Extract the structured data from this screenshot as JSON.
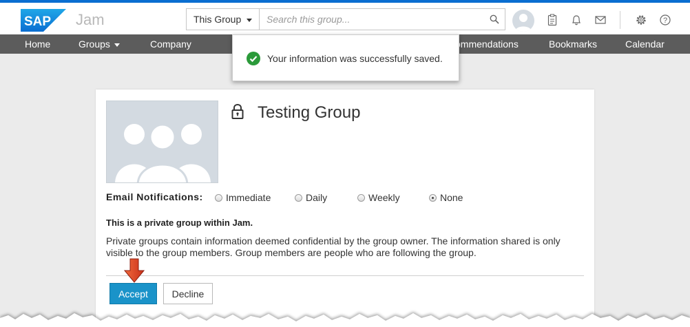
{
  "header": {
    "logo_text": "SAP",
    "app_name": "Jam",
    "scope_label": "This Group",
    "search_placeholder": "Search this group..."
  },
  "nav": {
    "items": [
      "Home",
      "Groups",
      "Company",
      "ommendations",
      "Bookmarks",
      "Calendar"
    ]
  },
  "toast": {
    "message": "Your information was successfully saved."
  },
  "group": {
    "title": "Testing Group",
    "notifications": {
      "label": "Email Notifications:",
      "options": [
        "Immediate",
        "Daily",
        "Weekly",
        "None"
      ],
      "selected": "None"
    },
    "private_heading": "This is a private group within Jam.",
    "private_description": "Private groups contain information deemed confidential by the group owner. The information shared is only visible to the group members. Group members are people who are following the group.",
    "accept_label": "Accept",
    "decline_label": "Decline"
  },
  "colors": {
    "brand_blue": "#0a6ed1",
    "nav_bg": "#5c5c5c",
    "accept_bg": "#1a93c9",
    "success_green": "#2b9a3a",
    "annotation_arrow": "#d9381e"
  }
}
